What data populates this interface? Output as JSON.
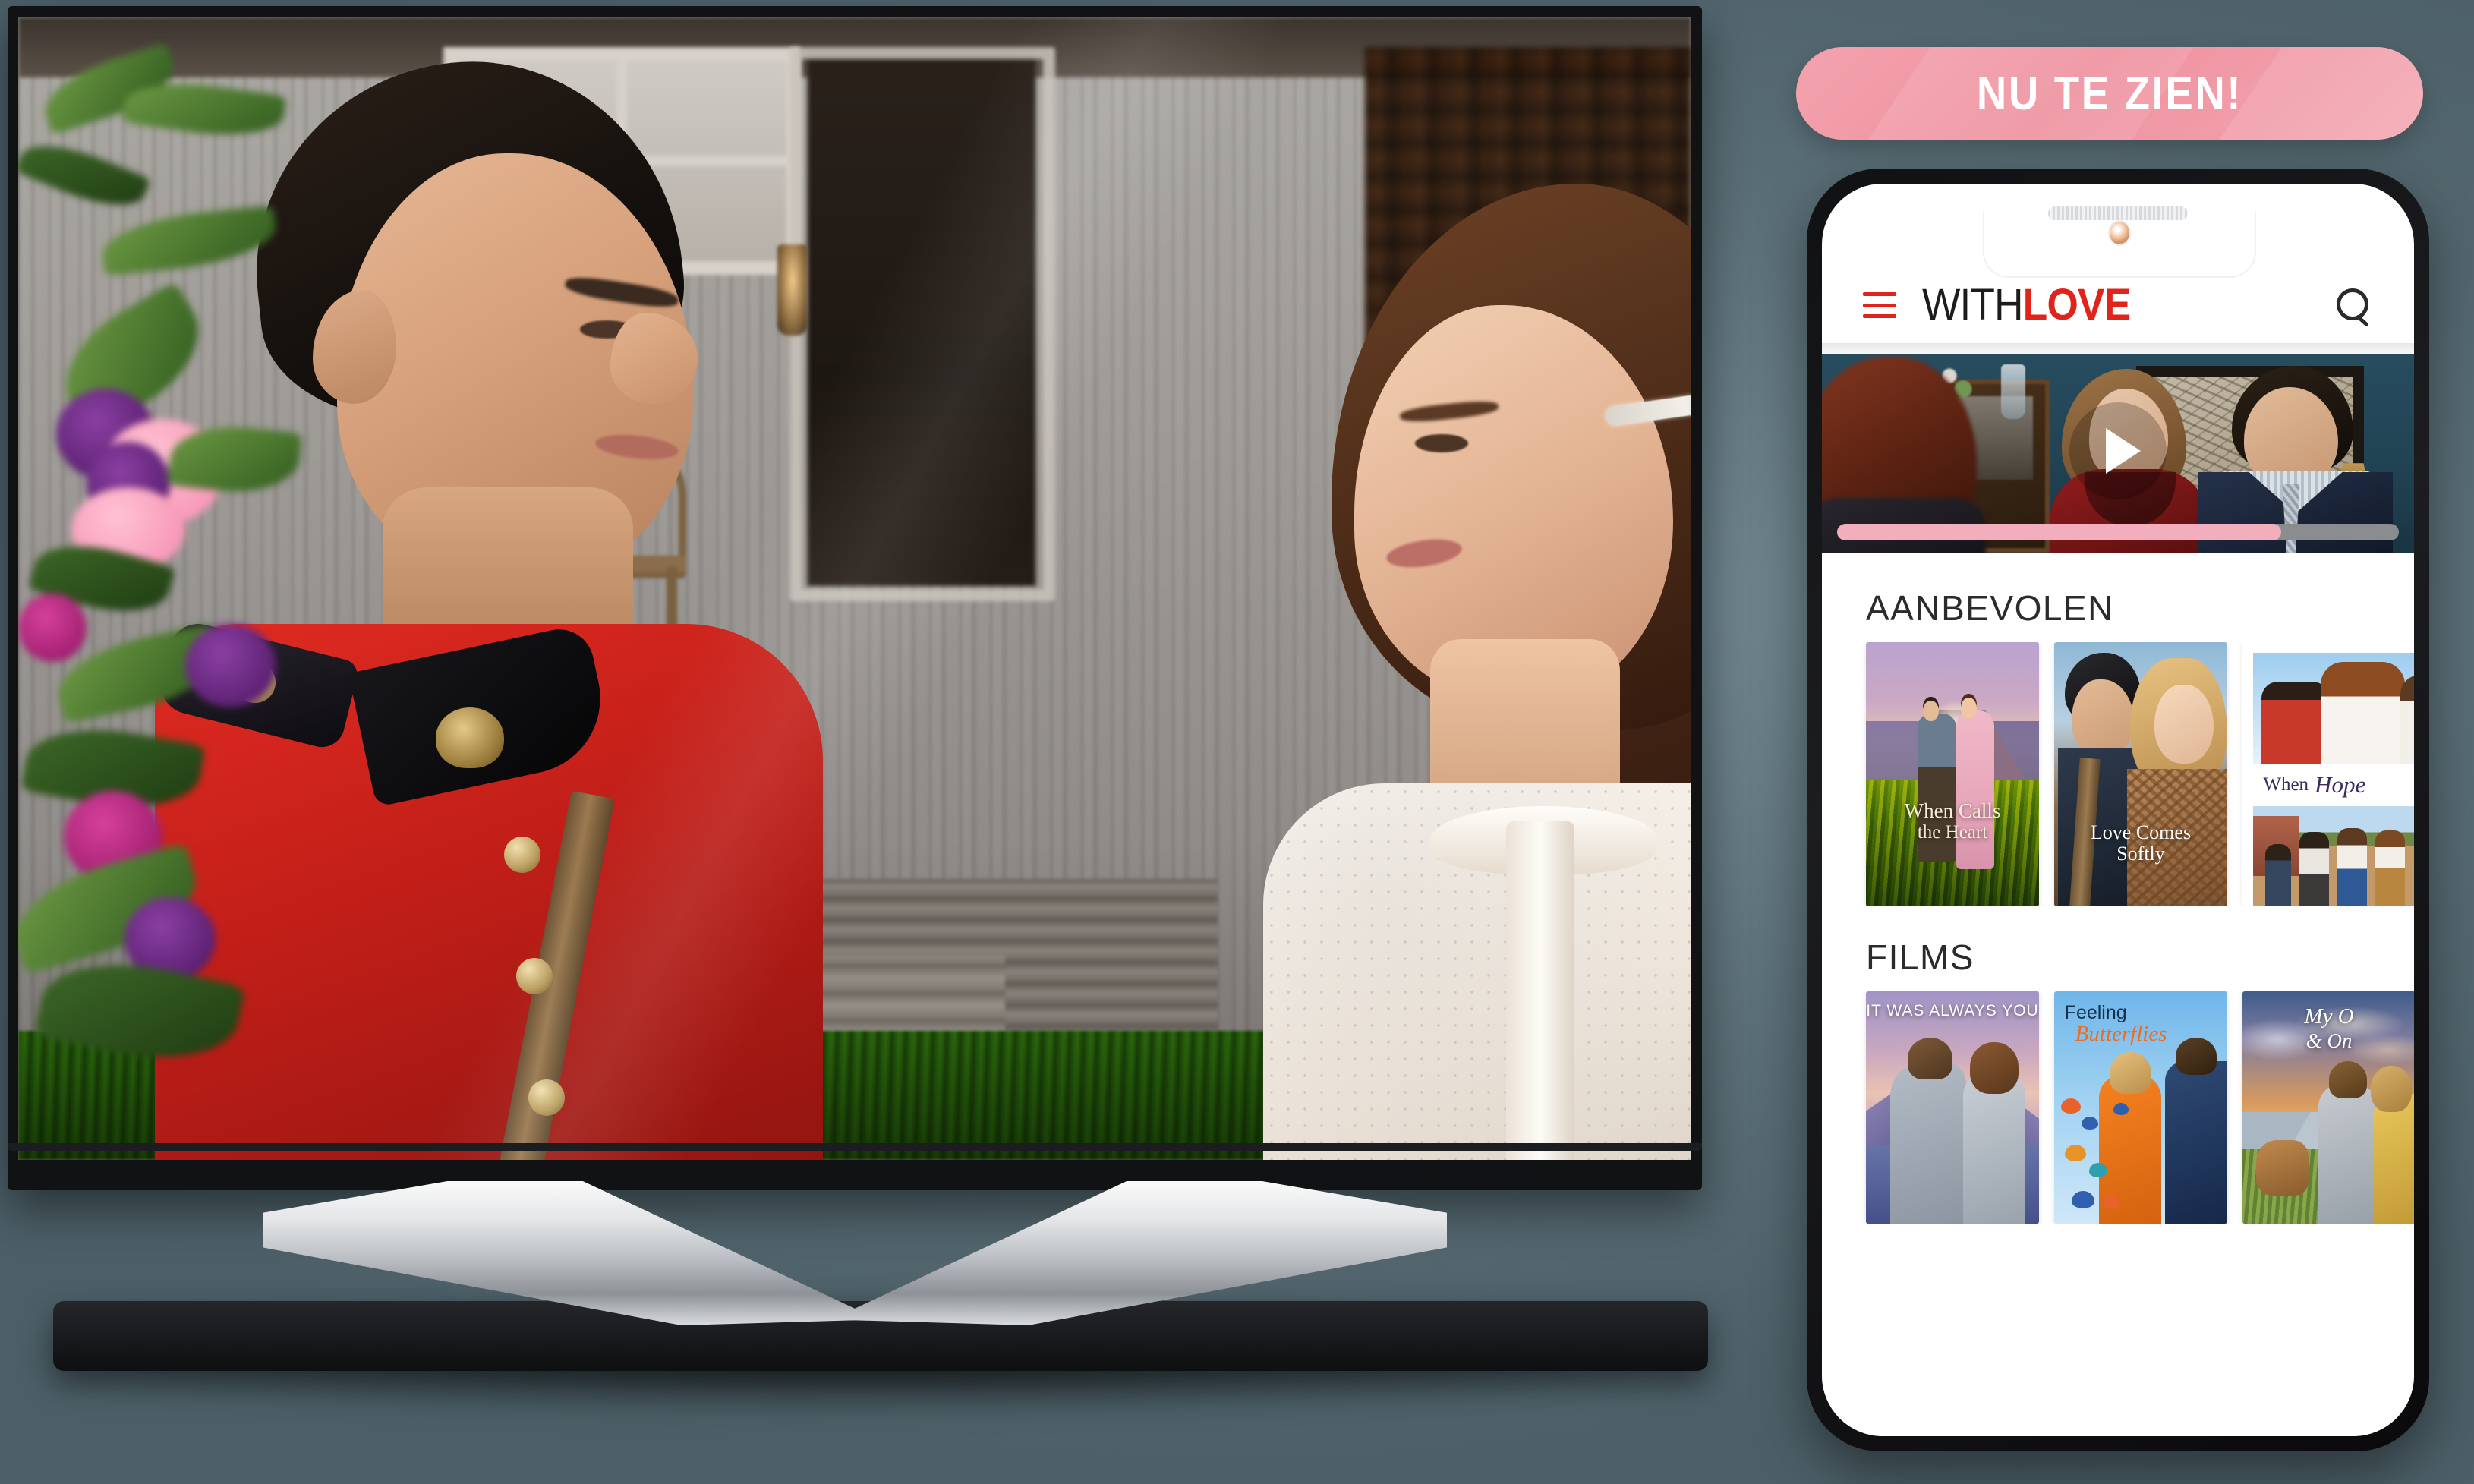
{
  "badge": {
    "label": "NU TE ZIEN!",
    "color": "#f0a0ac"
  },
  "tv": {
    "scene_description": "When Calls the Heart scene: a Mountie in red serge uniform facing a woman in a white blouse on a wooden porch"
  },
  "phone": {
    "header": {
      "menu_icon": "hamburger-icon",
      "brand_first": "WITH",
      "brand_second": "LOVE",
      "brand_accent_color": "#e0241b",
      "search_icon": "search-icon"
    },
    "hero": {
      "play_icon": "play-icon",
      "progress_percent": 79,
      "progress_fill_color": "#f2aebc",
      "progress_track_color": "#8a8d90",
      "scene_description": "Two people talking in a blue parlour room"
    },
    "sections": [
      {
        "title": "AANBEVOLEN",
        "items": [
          {
            "title_line1": "When Calls",
            "title_line2": "the Heart"
          },
          {
            "title_line1": "Love Comes",
            "title_line2": "Softly"
          },
          {
            "title_line1": "When",
            "title_line2": "Hope"
          }
        ]
      },
      {
        "title": "FILMS",
        "items": [
          {
            "title_line1": "IT WAS ALWAYS YOU",
            "title_line2": ""
          },
          {
            "title_line1": "Feeling",
            "title_line2": "Butterflies"
          },
          {
            "title_line1": "My O",
            "title_line2": "& On"
          }
        ]
      }
    ]
  }
}
